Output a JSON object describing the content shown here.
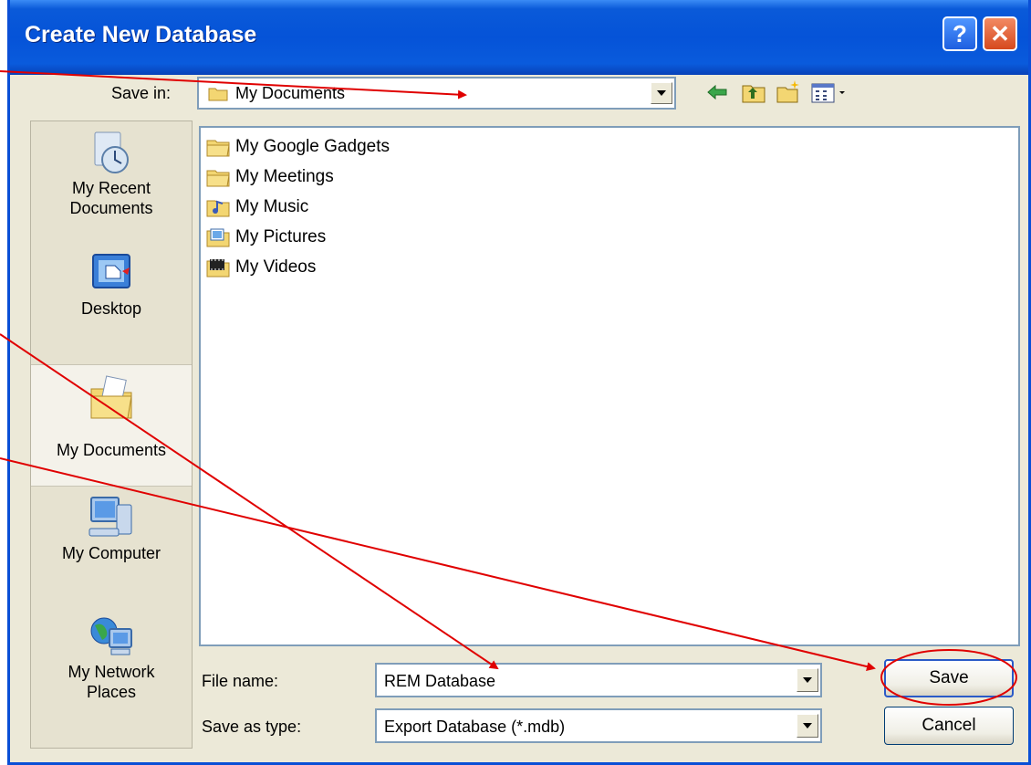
{
  "dialog": {
    "title": "Create New Database",
    "help_glyph": "?",
    "close_glyph": "✕"
  },
  "save_in": {
    "label": "Save in:",
    "value": "My Documents"
  },
  "toolbar": {
    "icons": [
      "back-arrow-icon",
      "up-one-level-icon",
      "new-folder-icon",
      "views-menu-icon"
    ]
  },
  "places": [
    {
      "label": "My Recent Documents",
      "line1": "My Recent",
      "line2": "Documents",
      "icon": "recent-documents-icon"
    },
    {
      "label": "Desktop",
      "line1": "Desktop",
      "line2": "",
      "icon": "desktop-icon"
    },
    {
      "label": "My Documents",
      "line1": "My Documents",
      "line2": "",
      "icon": "my-documents-icon"
    },
    {
      "label": "My Computer",
      "line1": "My Computer",
      "line2": "",
      "icon": "my-computer-icon"
    },
    {
      "label": "My Network Places",
      "line1": "My Network",
      "line2": "Places",
      "icon": "network-places-icon"
    }
  ],
  "files": [
    {
      "name": "My Google Gadgets",
      "icon": "folder-icon"
    },
    {
      "name": "My Meetings",
      "icon": "folder-icon"
    },
    {
      "name": "My Music",
      "icon": "music-folder-icon"
    },
    {
      "name": "My Pictures",
      "icon": "pictures-folder-icon"
    },
    {
      "name": "My Videos",
      "icon": "videos-folder-icon"
    }
  ],
  "file_name": {
    "label": "File name:",
    "value": "REM Database"
  },
  "save_as_type": {
    "label": "Save as type:",
    "value": "Export Database (*.mdb)"
  },
  "buttons": {
    "save": "Save",
    "cancel": "Cancel"
  },
  "colors": {
    "titlebar": "#0553d8",
    "dialog_bg": "#ece9d8",
    "annotation": "#e00000"
  }
}
